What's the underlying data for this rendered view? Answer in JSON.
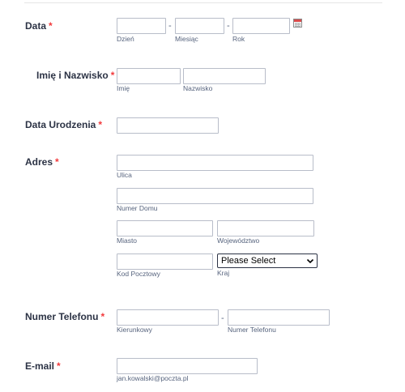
{
  "date": {
    "label": "Data",
    "required": "*",
    "separator": "-",
    "day_label": "Dzień",
    "month_label": "Miesiąc",
    "year_label": "Rok"
  },
  "name": {
    "label": "Imię i Nazwisko",
    "required": "*",
    "first_label": "Imię",
    "last_label": "Nazwisko"
  },
  "birthdate": {
    "label": "Data Urodzenia",
    "required": "*"
  },
  "address": {
    "label": "Adres",
    "required": "*",
    "street_label": "Ulica",
    "house_label": "Numer Domu",
    "city_label": "Miasto",
    "region_label": "Województwo",
    "postal_label": "Kod Pocztowy",
    "country_label": "Kraj",
    "country_selected": "Please Select"
  },
  "phone": {
    "label": "Numer Telefonu",
    "required": "*",
    "separator": "-",
    "area_label": "Kierunkowy",
    "number_label": "Numer Telefonu"
  },
  "email": {
    "label": "E-mail",
    "required": "*",
    "example": "jan.kowalski@poczta.pl"
  },
  "icons": {
    "calendar": "calendar-icon",
    "dropdown": "chevron-down-icon"
  },
  "colors": {
    "required": "#f23a3c",
    "label": "#2c3345",
    "sublabel": "#57647e",
    "input_border": "#b8bdc9"
  }
}
